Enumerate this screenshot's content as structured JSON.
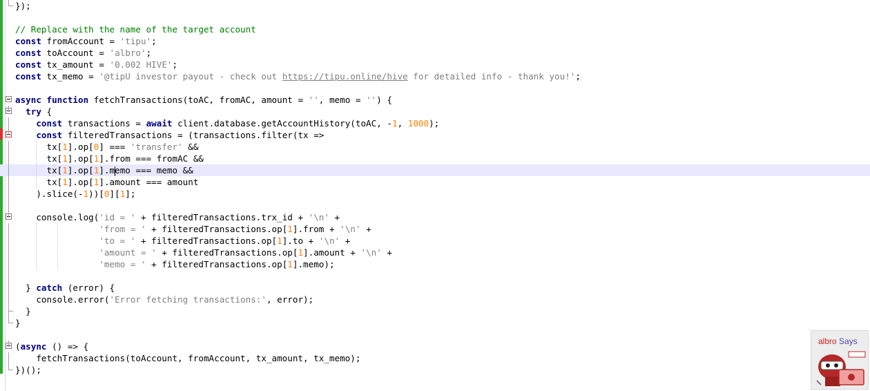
{
  "editor": {
    "lines": [
      {
        "fold": "end",
        "parts": [
          [
            "p",
            "});"
          ]
        ]
      },
      {
        "fold": "none",
        "parts": []
      },
      {
        "fold": "none",
        "parts": [
          [
            "cm",
            "// Replace with the name of the target account"
          ]
        ]
      },
      {
        "fold": "none",
        "parts": [
          [
            "kw",
            "const"
          ],
          [
            "p",
            " fromAccount = "
          ],
          [
            "str",
            "'tipu'"
          ],
          [
            "p",
            ";"
          ]
        ]
      },
      {
        "fold": "none",
        "parts": [
          [
            "kw",
            "const"
          ],
          [
            "p",
            " toAccount = "
          ],
          [
            "str",
            "'albro'"
          ],
          [
            "p",
            ";"
          ]
        ]
      },
      {
        "fold": "none",
        "parts": [
          [
            "kw",
            "const"
          ],
          [
            "p",
            " tx_amount = "
          ],
          [
            "str",
            "'0.002 HIVE'"
          ],
          [
            "p",
            ";"
          ]
        ]
      },
      {
        "fold": "none",
        "parts": [
          [
            "kw",
            "const"
          ],
          [
            "p",
            " tx_memo = "
          ],
          [
            "str",
            "'@tipU investor payout - check out "
          ],
          [
            "url",
            "https://tipu.online/hive"
          ],
          [
            "str",
            " for detailed info - thank you!'"
          ],
          [
            "p",
            ";"
          ]
        ]
      },
      {
        "fold": "none",
        "parts": []
      },
      {
        "fold": "start",
        "parts": [
          [
            "kw",
            "async function"
          ],
          [
            "p",
            " fetchTransactions(toAC, fromAC, amount = "
          ],
          [
            "str",
            "''"
          ],
          [
            "p",
            ", memo = "
          ],
          [
            "str",
            "''"
          ],
          [
            "p",
            ") {"
          ]
        ]
      },
      {
        "fold": "start",
        "parts": [
          [
            "p",
            "  "
          ],
          [
            "kw",
            "try"
          ],
          [
            "p",
            " {"
          ]
        ]
      },
      {
        "fold": "mid",
        "parts": [
          [
            "p",
            "    "
          ],
          [
            "kw",
            "const"
          ],
          [
            "p",
            " transactions = "
          ],
          [
            "kw",
            "await"
          ],
          [
            "p",
            " client.database.getAccountHistory(toAC, -"
          ],
          [
            "num",
            "1"
          ],
          [
            "p",
            ", "
          ],
          [
            "num",
            "1000"
          ],
          [
            "p",
            ");"
          ]
        ]
      },
      {
        "fold": "start-red",
        "parts": [
          [
            "p",
            "    "
          ],
          [
            "kw",
            "const"
          ],
          [
            "p",
            " filteredTransactions = (transactions.filter(tx =>"
          ]
        ]
      },
      {
        "fold": "mid",
        "guides": [
          1
        ],
        "parts": [
          [
            "p",
            "      tx["
          ],
          [
            "num",
            "1"
          ],
          [
            "p",
            "].op["
          ],
          [
            "num",
            "0"
          ],
          [
            "p",
            "] === "
          ],
          [
            "str",
            "'transfer'"
          ],
          [
            "p",
            " &&"
          ]
        ]
      },
      {
        "fold": "mid",
        "guides": [
          1
        ],
        "parts": [
          [
            "p",
            "      tx["
          ],
          [
            "num",
            "1"
          ],
          [
            "p",
            "].op["
          ],
          [
            "num",
            "1"
          ],
          [
            "p",
            "].from === fromAC &&"
          ]
        ]
      },
      {
        "fold": "mid",
        "guides": [
          1
        ],
        "current": true,
        "parts": [
          [
            "p",
            "      tx["
          ],
          [
            "num",
            "1"
          ],
          [
            "p",
            "].op["
          ],
          [
            "num",
            "1"
          ],
          [
            "p",
            "].m"
          ],
          [
            "caret",
            ""
          ],
          [
            "p",
            "emo === memo &&"
          ]
        ]
      },
      {
        "fold": "mid",
        "guides": [
          1
        ],
        "parts": [
          [
            "p",
            "      tx["
          ],
          [
            "num",
            "1"
          ],
          [
            "p",
            "].op["
          ],
          [
            "num",
            "1"
          ],
          [
            "p",
            "].amount === amount"
          ]
        ]
      },
      {
        "fold": "mid",
        "parts": [
          [
            "p",
            "    ).slice(-"
          ],
          [
            "num",
            "1"
          ],
          [
            "p",
            "))["
          ],
          [
            "num",
            "0"
          ],
          [
            "p",
            "]["
          ],
          [
            "num",
            "1"
          ],
          [
            "p",
            "];"
          ]
        ]
      },
      {
        "fold": "mid",
        "parts": []
      },
      {
        "fold": "start",
        "parts": [
          [
            "p",
            "    console.log("
          ],
          [
            "str",
            "'id = '"
          ],
          [
            "p",
            " + filteredTransactions.trx_id + "
          ],
          [
            "str",
            "'\\n'"
          ],
          [
            "p",
            " +"
          ]
        ]
      },
      {
        "fold": "mid",
        "guides": [
          1,
          2
        ],
        "parts": [
          [
            "p",
            "                "
          ],
          [
            "str",
            "'from = '"
          ],
          [
            "p",
            " + filteredTransactions.op["
          ],
          [
            "num",
            "1"
          ],
          [
            "p",
            "].from + "
          ],
          [
            "str",
            "'\\n'"
          ],
          [
            "p",
            " +"
          ]
        ]
      },
      {
        "fold": "mid",
        "guides": [
          1,
          2
        ],
        "parts": [
          [
            "p",
            "                "
          ],
          [
            "str",
            "'to = '"
          ],
          [
            "p",
            " + filteredTransactions.op["
          ],
          [
            "num",
            "1"
          ],
          [
            "p",
            "].to + "
          ],
          [
            "str",
            "'\\n'"
          ],
          [
            "p",
            " +"
          ]
        ]
      },
      {
        "fold": "mid",
        "guides": [
          1,
          2
        ],
        "parts": [
          [
            "p",
            "                "
          ],
          [
            "str",
            "'amount = '"
          ],
          [
            "p",
            " + filteredTransactions.op["
          ],
          [
            "num",
            "1"
          ],
          [
            "p",
            "].amount + "
          ],
          [
            "str",
            "'\\n'"
          ],
          [
            "p",
            " +"
          ]
        ]
      },
      {
        "fold": "mid",
        "guides": [
          1,
          2
        ],
        "parts": [
          [
            "p",
            "                "
          ],
          [
            "str",
            "'memo = '"
          ],
          [
            "p",
            " + filteredTransactions.op["
          ],
          [
            "num",
            "1"
          ],
          [
            "p",
            "].memo);"
          ]
        ]
      },
      {
        "fold": "mid",
        "parts": []
      },
      {
        "fold": "mid",
        "parts": [
          [
            "p",
            "  } "
          ],
          [
            "kw",
            "catch"
          ],
          [
            "p",
            " (error) {"
          ]
        ]
      },
      {
        "fold": "mid",
        "parts": [
          [
            "p",
            "    console.error("
          ],
          [
            "str",
            "'Error fetching transactions:'"
          ],
          [
            "p",
            ", error);"
          ]
        ]
      },
      {
        "fold": "mid-end",
        "parts": [
          [
            "p",
            "  }"
          ]
        ]
      },
      {
        "fold": "end",
        "parts": [
          [
            "p",
            "}"
          ]
        ]
      },
      {
        "fold": "none",
        "parts": []
      },
      {
        "fold": "start",
        "parts": [
          [
            "p",
            "("
          ],
          [
            "kw",
            "async"
          ],
          [
            "p",
            " () => {"
          ]
        ]
      },
      {
        "fold": "mid",
        "parts": [
          [
            "p",
            "    fetchTransactions(toAccount, fromAccount, tx_amount, tx_memo);"
          ]
        ]
      },
      {
        "fold": "end",
        "parts": [
          [
            "p",
            "})();"
          ]
        ]
      }
    ]
  },
  "badge": {
    "name": "albro",
    "says": "Says",
    "colors": {
      "name": "#cc1f1f",
      "says": "#4a4aa8",
      "robot": "#b62828"
    }
  }
}
